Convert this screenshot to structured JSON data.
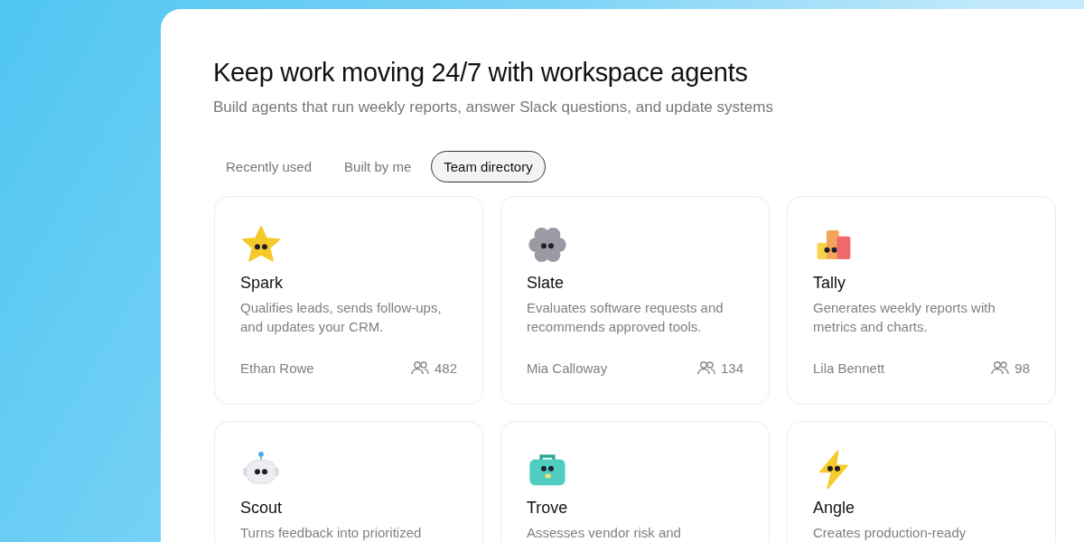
{
  "heading": "Keep work moving 24/7 with workspace agents",
  "subheading": "Build agents that run weekly reports, answer Slack questions, and update systems",
  "tabs": [
    {
      "label": "Recently used",
      "selected": false
    },
    {
      "label": "Built by me",
      "selected": false
    },
    {
      "label": "Team directory",
      "selected": true
    }
  ],
  "agents": [
    {
      "kind": "star",
      "name": "Spark",
      "description": "Qualifies leads, sends follow-ups, and updates your CRM.",
      "owner": "Ethan Rowe",
      "users": "482"
    },
    {
      "kind": "gear",
      "name": "Slate",
      "description": "Evaluates software requests and recommends approved tools.",
      "owner": "Mia Calloway",
      "users": "134"
    },
    {
      "kind": "bars",
      "name": "Tally",
      "description": "Generates weekly reports with metrics and charts.",
      "owner": "Lila Bennett",
      "users": "98"
    },
    {
      "kind": "robot",
      "name": "Scout",
      "description": "Turns feedback into prioritized"
    },
    {
      "kind": "briefcase",
      "name": "Trove",
      "description": "Assesses vendor risk and"
    },
    {
      "kind": "bolt",
      "name": "Angle",
      "description": "Creates production-ready"
    }
  ]
}
